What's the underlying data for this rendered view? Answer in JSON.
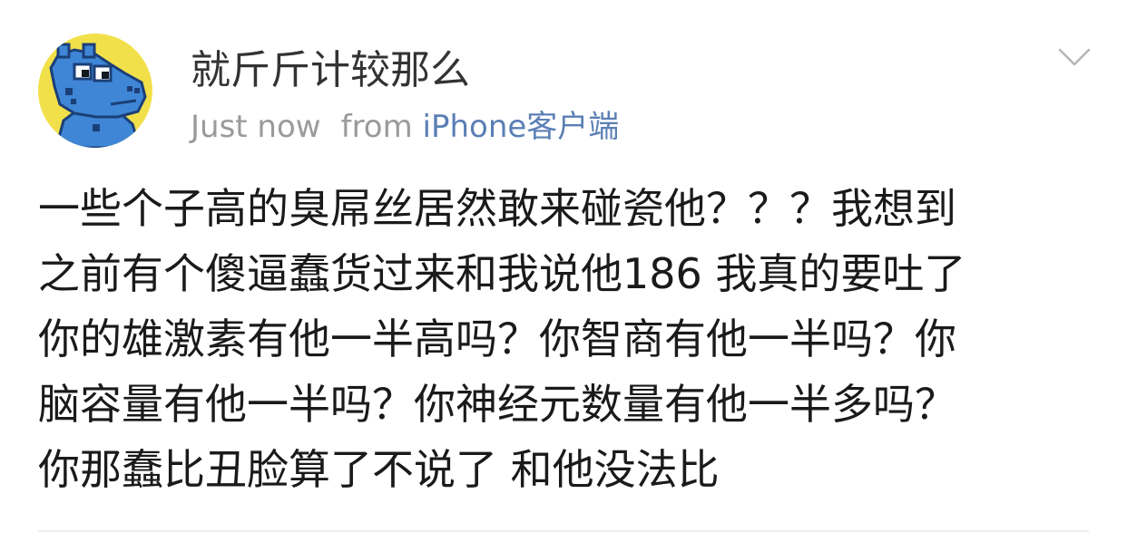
{
  "post": {
    "user": {
      "name": "就斤斤计较那么",
      "avatar_icon": "blue-cartoon-hippo-avatar"
    },
    "time": "Just now",
    "from_label": "from",
    "source": "iPhone客户端",
    "menu_icon": "chevron-down-icon",
    "lines": [
      "一些个子高的臭屌丝居然敢来碰瓷他？？？我想到",
      "之前有个傻逼蠢货过来和我说他186 我真的要吐了",
      "你的雄激素有他一半高吗？你智商有他一半吗？你",
      "脑容量有他一半吗？你神经元数量有他一半多吗？",
      "你那蠢比丑脸算了不说了 和他没法比"
    ]
  },
  "colors": {
    "username": "#333333",
    "meta": "#9a9a9a",
    "source_link": "#5b7fb5",
    "body_text": "#1a1a1a",
    "avatar_background": "#f2e04a",
    "avatar_character": "#3f86d6"
  }
}
